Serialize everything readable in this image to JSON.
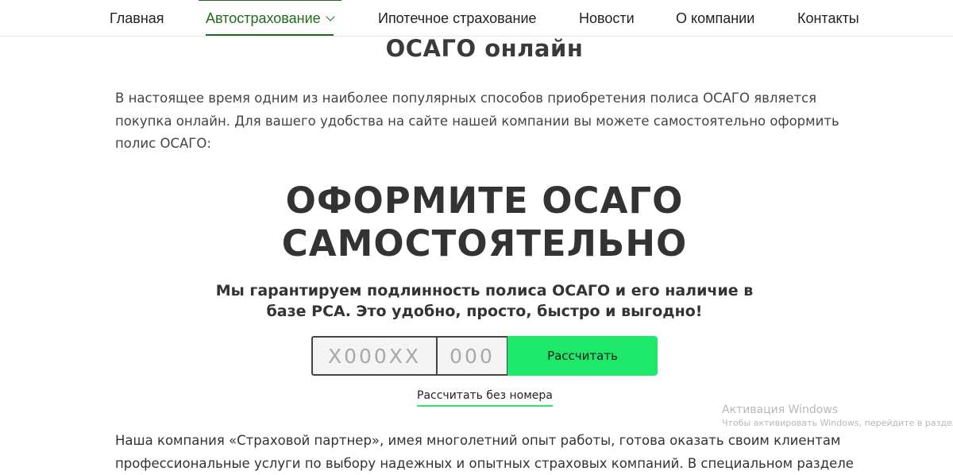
{
  "nav": {
    "items": [
      {
        "label": "Главная"
      },
      {
        "label": "Автострахование"
      },
      {
        "label": "Ипотечное страхование"
      },
      {
        "label": "Новости"
      },
      {
        "label": "О компании"
      },
      {
        "label": "Контакты"
      }
    ],
    "active_index": 1,
    "accent_color": "#1f6b1f"
  },
  "page": {
    "title": "ОСАГО онлайн",
    "intro": "В настоящее время одним из наиболее популярных способов приобретения полиса ОСАГО является покупка онлайн. Для вашего удобства на сайте нашей компании вы можете самостоятельно оформить полис ОСАГО:"
  },
  "promo": {
    "heading_line1": "ОФОРМИТЕ ОСАГО",
    "heading_line2": "САМОСТОЯТЕЛЬНО",
    "subheading_line1": "Мы гарантируем подлинность полиса ОСАГО и его наличие в",
    "subheading_line2": "базе РСА. Это удобно, просто, быстро и выгодно!",
    "plate_number_placeholder": "X000XX",
    "plate_number_value": "",
    "plate_region_placeholder": "000",
    "plate_region_value": "",
    "calculate_button": "Рассчитать",
    "calculate_without_number_link": "Рассчитать без номера",
    "button_color": "#1de86a"
  },
  "body": {
    "line1": "Наша компания «Страховой партнер», имея многолетний опыт работы, готова оказать своим клиентам",
    "line2": "профессиональные услуги по выбору надежных и опытных страховых компаний. В специальном разделе"
  },
  "watermark": {
    "title": "Активация Windows",
    "subtitle": "Чтобы активировать Windows, перейдите в раздел"
  }
}
